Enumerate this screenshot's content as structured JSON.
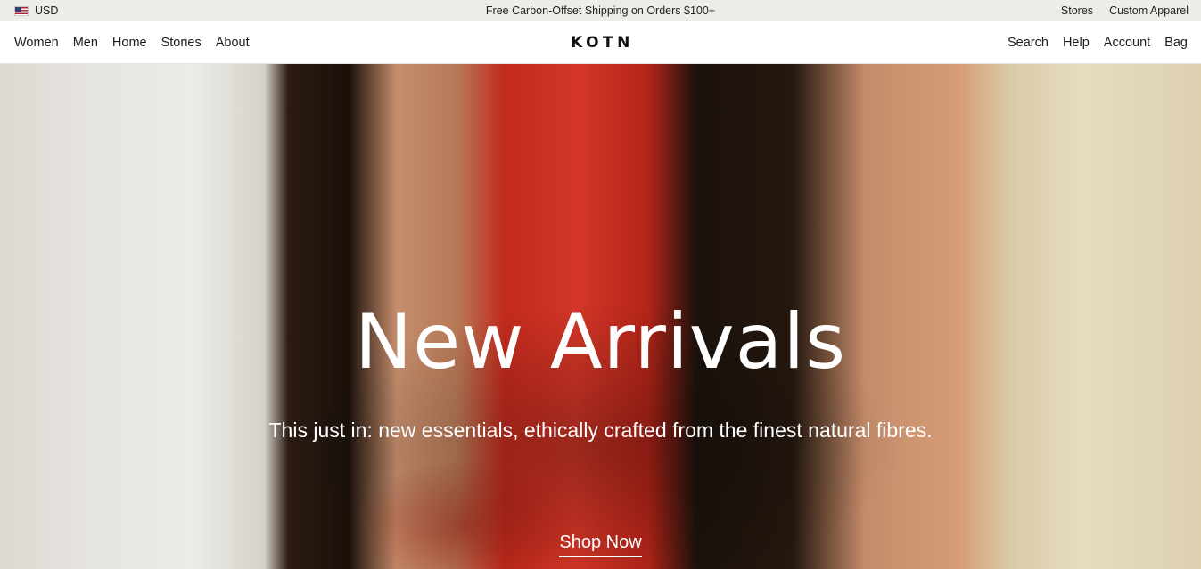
{
  "announcement": {
    "currency": "USD",
    "flag_icon": "us-flag-icon",
    "promo_text": "Free Carbon-Offset Shipping on Orders $100+",
    "utility_links": [
      "Stores",
      "Custom Apparel"
    ]
  },
  "nav": {
    "left_links": [
      "Women",
      "Men",
      "Home",
      "Stories",
      "About"
    ],
    "logo": "KOTN",
    "right_links": [
      "Search",
      "Help",
      "Account",
      "Bag"
    ]
  },
  "hero": {
    "title": "New Arrivals",
    "subtitle": "This just in: new essentials, ethically crafted from the finest natural fibres.",
    "cta_label": "Shop Now"
  },
  "colors": {
    "announcement_bg": "#eeece8",
    "nav_bg": "#ffffff",
    "hero_text": "#ffffff",
    "dress_red": "#c22a1c"
  }
}
